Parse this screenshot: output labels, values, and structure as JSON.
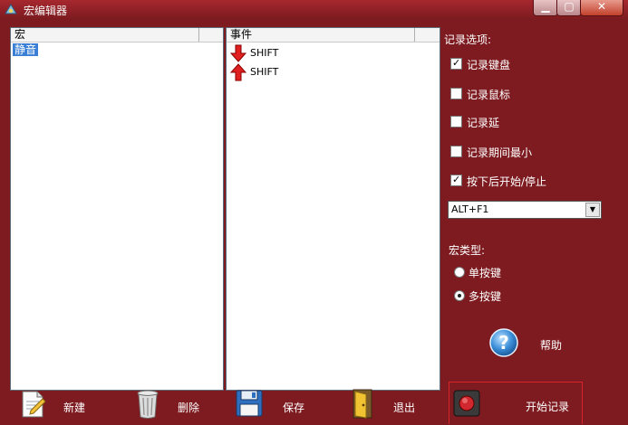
{
  "window": {
    "title": "宏编辑器"
  },
  "macro_panel": {
    "header": "宏",
    "items": [
      "静音"
    ]
  },
  "event_panel": {
    "header": "事件",
    "events": [
      {
        "direction": "down",
        "key": "SHIFT"
      },
      {
        "direction": "up",
        "key": "SHIFT"
      }
    ]
  },
  "record_options": {
    "label": "记录选项:",
    "checkboxes": [
      {
        "label": "记录键盘",
        "checked": true
      },
      {
        "label": "记录鼠标",
        "checked": false
      },
      {
        "label": "记录延",
        "checked": false
      },
      {
        "label": "记录期间最小",
        "checked": false
      },
      {
        "label": "按下后开始/停止",
        "checked": true
      }
    ],
    "hotkey": "ALT+F1"
  },
  "macro_type": {
    "label": "宏类型:",
    "options": [
      {
        "label": "单按键",
        "selected": false
      },
      {
        "label": "多按键",
        "selected": true
      }
    ]
  },
  "help": {
    "label": "帮助"
  },
  "toolbar": {
    "new_label": "新建",
    "delete_label": "删除",
    "save_label": "保存",
    "exit_label": "退出",
    "record_label": "开始记录"
  },
  "colors": {
    "background": "#7d1b20",
    "accent_red": "#d8232a",
    "selection": "#3a7fd5"
  }
}
